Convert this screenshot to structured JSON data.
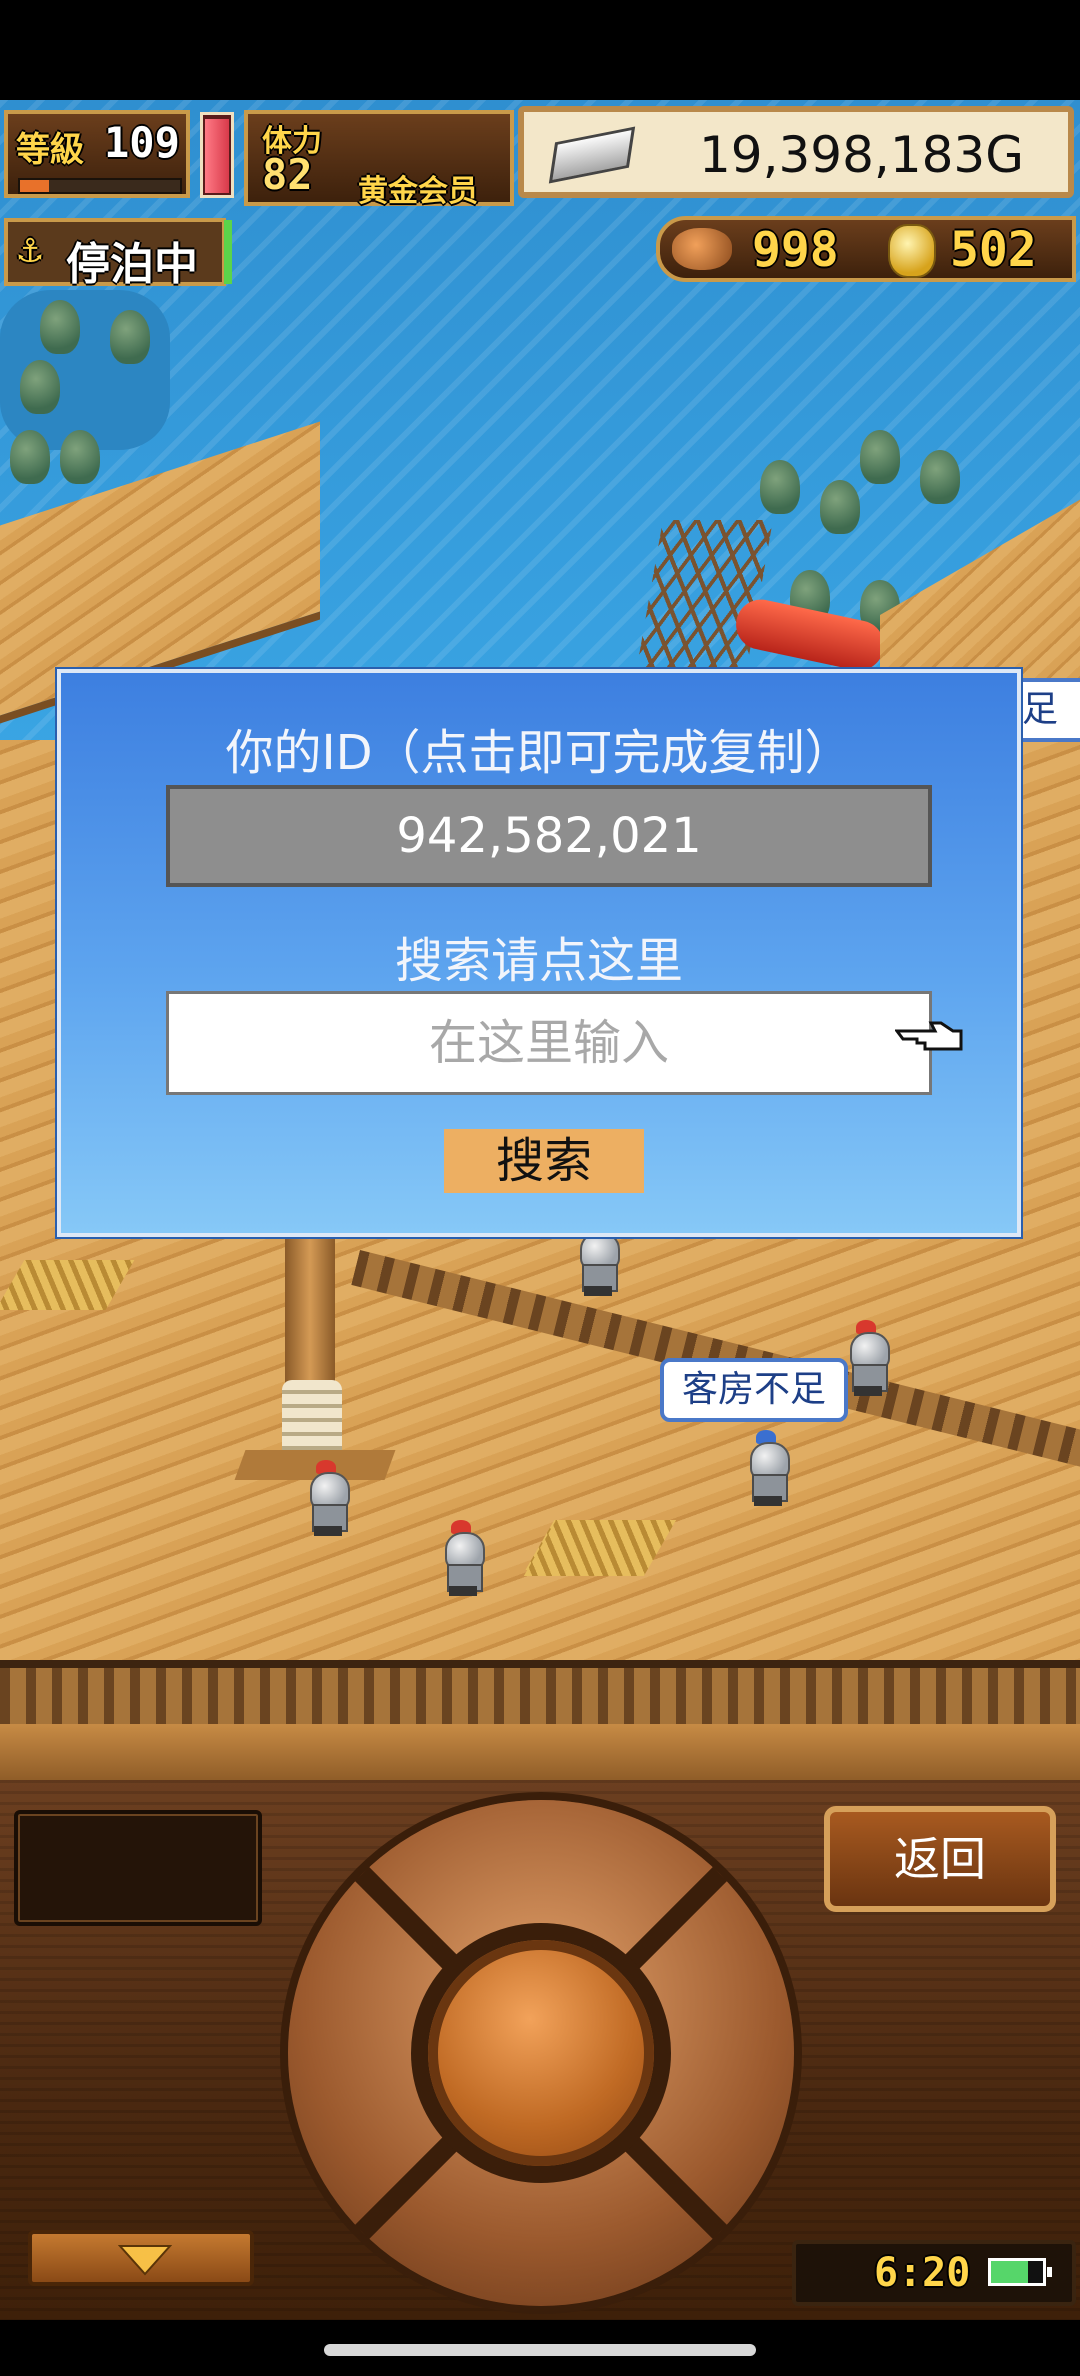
{
  "hud": {
    "level_label": "等級",
    "level_value": "109",
    "stamina_label": "体力",
    "stamina_value": "82",
    "membership": "黄金会员",
    "money": "19,398,183G",
    "anchor_status": "停泊中",
    "resource_1": "998",
    "resource_2": "502"
  },
  "scene": {
    "speech_bubble": "客房不足",
    "edge_bubble": "足"
  },
  "dialog": {
    "id_label": "你的ID（点击即可完成复制）",
    "id_value": "942,582,021",
    "search_label": "搜索请点这里",
    "search_placeholder": "在这里输入",
    "search_button": "搜索"
  },
  "controls": {
    "back_button": "返回",
    "clock": "6:20"
  },
  "colors": {
    "dialog_top": "#3d7fe0",
    "dialog_bottom": "#86c8f7",
    "search_button": "#edaf62",
    "id_box": "#8e8e8e"
  }
}
